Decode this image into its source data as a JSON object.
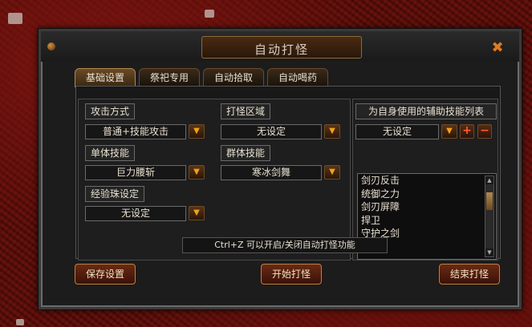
{
  "window": {
    "title": "自动打怪"
  },
  "tabs": [
    {
      "label": "基础设置",
      "active": true
    },
    {
      "label": "祭祀专用",
      "active": false
    },
    {
      "label": "自动拾取",
      "active": false
    },
    {
      "label": "自动喝药",
      "active": false
    }
  ],
  "settings": {
    "attack_mode": {
      "label": "攻击方式",
      "value": "普通+技能攻击"
    },
    "attack_area": {
      "label": "打怪区域",
      "value": "无设定"
    },
    "single_skill": {
      "label": "单体技能",
      "value": "巨力腰斩"
    },
    "group_skill": {
      "label": "群体技能",
      "value": "寒冰剑舞"
    },
    "exp_orb": {
      "label": "经验珠设定",
      "value": "无设定"
    }
  },
  "self_buffs": {
    "header": "为自身使用的辅助技能列表",
    "select_value": "无设定",
    "items": [
      "剑刃反击",
      "统御之力",
      "剑刃屏障",
      "捍卫",
      "守护之剑"
    ]
  },
  "hint": "Ctrl+Z 可以开启/关闭自动打怪功能",
  "buttons": {
    "save": "保存设置",
    "start": "开始打怪",
    "end": "结束打怪"
  },
  "icons": {
    "close": "close-icon",
    "dropdown": "triangle-down-icon",
    "add": "plus-icon",
    "remove": "minus-icon"
  },
  "colors": {
    "accent": "#e07a20",
    "background": "#5a0e0a",
    "panel": "#1c1c1c"
  }
}
